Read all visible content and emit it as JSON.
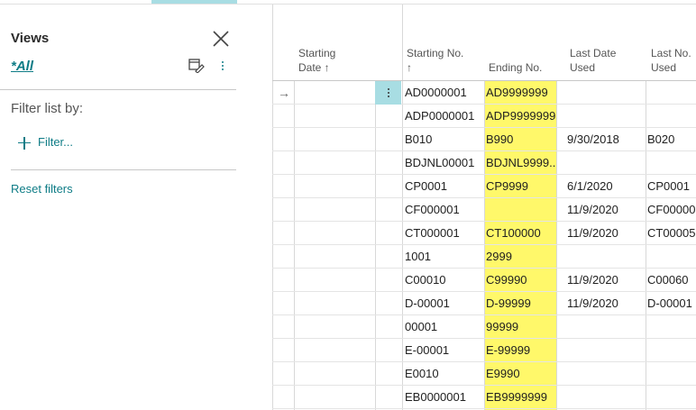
{
  "views_pane": {
    "title": "Views",
    "all_label": "*All",
    "filter_heading": "Filter list by:",
    "add_filter": "Filter...",
    "reset_filters": "Reset filters"
  },
  "table": {
    "headers": {
      "starting_date": [
        "Starting",
        "Date ↑"
      ],
      "starting_no": [
        "Starting No.",
        "↑"
      ],
      "ending_no": "Ending No.",
      "last_date_used": [
        "Last Date",
        "Used"
      ],
      "last_no_used": [
        "Last No.",
        "Used"
      ]
    },
    "rows": [
      {
        "starting_no": "AD0000001",
        "ending_no": "AD9999999",
        "last_date": "",
        "last_no": ""
      },
      {
        "starting_no": "ADP0000001",
        "ending_no": "ADP9999999",
        "last_date": "",
        "last_no": ""
      },
      {
        "starting_no": "B010",
        "ending_no": "B990",
        "last_date": "9/30/2018",
        "last_no": "B020"
      },
      {
        "starting_no": "BDJNL00001",
        "ending_no": "BDJNL9999...",
        "last_date": "",
        "last_no": ""
      },
      {
        "starting_no": "CP0001",
        "ending_no": "CP9999",
        "last_date": "6/1/2020",
        "last_no": "CP0001"
      },
      {
        "starting_no": "CF000001",
        "ending_no": "",
        "last_date": "11/9/2020",
        "last_no": "CF00000"
      },
      {
        "starting_no": "CT000001",
        "ending_no": "CT100000",
        "last_date": "11/9/2020",
        "last_no": "CT00005"
      },
      {
        "starting_no": "1001",
        "ending_no": "2999",
        "last_date": "",
        "last_no": ""
      },
      {
        "starting_no": "C00010",
        "ending_no": "C99990",
        "last_date": "11/9/2020",
        "last_no": "C00060"
      },
      {
        "starting_no": "D-00001",
        "ending_no": "D-99999",
        "last_date": "11/9/2020",
        "last_no": "D-00001"
      },
      {
        "starting_no": "00001",
        "ending_no": "99999",
        "last_date": "",
        "last_no": ""
      },
      {
        "starting_no": "E-00001",
        "ending_no": "E-99999",
        "last_date": "",
        "last_no": ""
      },
      {
        "starting_no": "E0010",
        "ending_no": "E9990",
        "last_date": "",
        "last_no": ""
      },
      {
        "starting_no": "EB0000001",
        "ending_no": "EB9999999",
        "last_date": "",
        "last_no": ""
      }
    ],
    "current_row_indicator": "→",
    "highlight_color": "#fff86a",
    "accent_color": "#0e7c86"
  }
}
